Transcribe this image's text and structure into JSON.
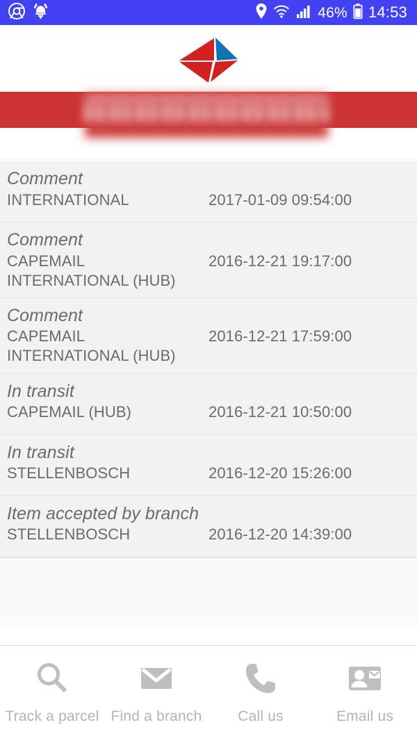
{
  "statusbar": {
    "left_icons": [
      {
        "name": "chrome-icon"
      },
      {
        "name": "viking-helmet-icon"
      }
    ],
    "right_icons": [
      {
        "name": "location-pin-icon"
      },
      {
        "name": "wifi-icon"
      },
      {
        "name": "cellular-signal-icon"
      },
      {
        "name": "battery-icon"
      }
    ],
    "battery_percent": "46%",
    "clock": "14:53",
    "background_color": "#4242f2",
    "text_color": "#ffffff"
  },
  "header": {
    "logo_name": "sapo-diamond-logo",
    "logo_colors": {
      "red": "#d32020",
      "blue": "#1073b4"
    }
  },
  "banner": {
    "background_color": "#cb3333",
    "tracking_number_redacted": true
  },
  "tracking": {
    "events": [
      {
        "status": "Comment",
        "location": "INTERNATIONAL",
        "datetime": "2017-01-09 09:54:00"
      },
      {
        "status": "Comment",
        "location": "CAPEMAIL INTERNATIONAL (HUB)",
        "datetime": "2016-12-21 19:17:00"
      },
      {
        "status": "Comment",
        "location": "CAPEMAIL INTERNATIONAL (HUB)",
        "datetime": "2016-12-21 17:59:00"
      },
      {
        "status": "In transit",
        "location": "CAPEMAIL (HUB)",
        "datetime": "2016-12-21 10:50:00"
      },
      {
        "status": "In transit",
        "location": "STELLENBOSCH",
        "datetime": "2016-12-20 15:26:00"
      },
      {
        "status": "Item accepted by branch",
        "location": "STELLENBOSCH",
        "datetime": "2016-12-20 14:39:00"
      }
    ]
  },
  "bottomnav": {
    "items": [
      {
        "label": "Track a parcel",
        "icon": "search-icon"
      },
      {
        "label": "Find a branch",
        "icon": "envelope-icon"
      },
      {
        "label": "Call us",
        "icon": "phone-icon"
      },
      {
        "label": "Email us",
        "icon": "contact-mail-icon"
      }
    ],
    "icon_color": "#bfbfbf",
    "label_color": "#b4b4b4"
  }
}
